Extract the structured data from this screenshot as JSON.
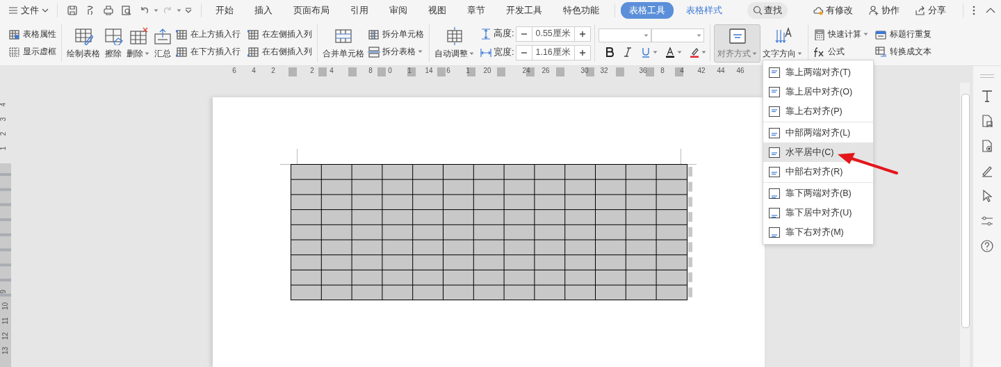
{
  "menu_bar": {
    "file_menu": {
      "label": "文件"
    },
    "tabs": [
      {
        "label": "开始",
        "kind": "main",
        "selected": false
      },
      {
        "label": "插入",
        "kind": "main",
        "selected": false
      },
      {
        "label": "页面布局",
        "kind": "main",
        "selected": false
      },
      {
        "label": "引用",
        "kind": "main",
        "selected": false
      },
      {
        "label": "审阅",
        "kind": "main",
        "selected": false
      },
      {
        "label": "视图",
        "kind": "main",
        "selected": false
      },
      {
        "label": "章节",
        "kind": "main",
        "selected": false
      },
      {
        "label": "开发工具",
        "kind": "main",
        "selected": false
      },
      {
        "label": "特色功能",
        "kind": "main",
        "selected": false
      },
      {
        "label": "表格工具",
        "kind": "contextual",
        "selected": true
      },
      {
        "label": "表格样式",
        "kind": "contextual",
        "selected": false
      }
    ],
    "search": {
      "label": "查找"
    },
    "actions": [
      {
        "label": "有修改"
      },
      {
        "label": "协作"
      },
      {
        "label": "分享"
      }
    ]
  },
  "ribbon": {
    "table_options": [
      {
        "label": "表格属性"
      },
      {
        "label": "显示虚框"
      }
    ],
    "edit_buttons": [
      {
        "label": "绘制表格",
        "dropdown": false
      },
      {
        "label": "擦除",
        "dropdown": false
      },
      {
        "label": "删除",
        "dropdown": true
      },
      {
        "label": "汇总",
        "dropdown": false
      }
    ],
    "insert_buttons": [
      {
        "label": "在上方插入行"
      },
      {
        "label": "在下方插入行"
      },
      {
        "label": "在左侧插入列"
      },
      {
        "label": "在右侧插入列"
      }
    ],
    "merge_button": {
      "label": "合并单元格"
    },
    "split_buttons": [
      {
        "label": "拆分单元格",
        "dropdown": false
      },
      {
        "label": "拆分表格",
        "dropdown": true
      }
    ],
    "auto_fit": {
      "label": "自动调整",
      "dropdown": true
    },
    "size_fields": [
      {
        "label": "高度:",
        "value": "0.55厘米"
      },
      {
        "label": "宽度:",
        "value": "1.16厘米"
      }
    ],
    "alignment": {
      "label": "对齐方式",
      "pressed": true
    },
    "text_direction": {
      "label": "文字方向"
    },
    "tools": [
      {
        "label": "快速计算",
        "dropdown": true
      },
      {
        "label": "公式",
        "dropdown": false
      },
      {
        "label": "标题行重复",
        "dropdown": false
      },
      {
        "label": "转换成文本",
        "dropdown": false
      }
    ]
  },
  "ruler": {
    "horizontal": [
      "6",
      "4",
      "2",
      "2",
      "4",
      "8",
      "0",
      "1",
      "14",
      "6",
      "1",
      "20",
      "24",
      "26",
      "30",
      "32",
      "36",
      "8",
      "4",
      "42",
      "44",
      "46"
    ],
    "vertical": [
      "4",
      "3",
      "2",
      "1",
      "9",
      "10",
      "11",
      "12",
      "13"
    ]
  },
  "alignment_menu": {
    "groups": [
      [
        {
          "label": "靠上两端对齐(T)",
          "kind": "top",
          "selected": false
        },
        {
          "label": "靠上居中对齐(O)",
          "kind": "top",
          "selected": false
        },
        {
          "label": "靠上右对齐(P)",
          "kind": "top",
          "selected": false
        }
      ],
      [
        {
          "label": "中部两端对齐(L)",
          "kind": "middle",
          "selected": false
        },
        {
          "label": "水平居中(C)",
          "kind": "middle",
          "selected": true
        },
        {
          "label": "中部右对齐(R)",
          "kind": "middle",
          "selected": false
        }
      ],
      [
        {
          "label": "靠下两端对齐(B)",
          "kind": "bottom",
          "selected": false
        },
        {
          "label": "靠下居中对齐(U)",
          "kind": "bottom",
          "selected": false
        },
        {
          "label": "靠下右对齐(M)",
          "kind": "bottom",
          "selected": false
        }
      ]
    ]
  }
}
